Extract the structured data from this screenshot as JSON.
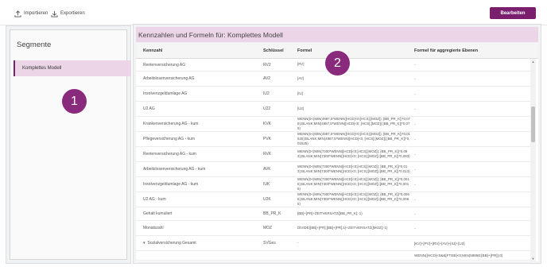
{
  "toolbar": {
    "import_label": "Importieren",
    "export_label": "Exportieren",
    "edit_label": "Bearbeiten"
  },
  "segments": {
    "title": "Segmente",
    "items": [
      {
        "label": "Komplettes Modell"
      }
    ]
  },
  "markers": [
    "1",
    "2"
  ],
  "main": {
    "title": "Kennzahlen und Formeln für: Komplettes Modell",
    "columns": [
      "Kennzahl",
      "Schlüssel",
      "Formel",
      "Formel für aggregierte Ebenen"
    ],
    "rows": [
      {
        "name": "Rentenversicherung AG",
        "key": "RV2",
        "formula": "[RV]",
        "agg": "-"
      },
      {
        "name": "Arbeitslosenversicherung AG",
        "key": "AV2",
        "formula": "[AV]",
        "agg": "-"
      },
      {
        "name": "Insolvenzgeldumlage AG",
        "key": "IU2",
        "formula": "[IU]",
        "agg": "-"
      },
      {
        "name": "U2 AG",
        "key": "U22",
        "formula": "[U2]",
        "agg": "-"
      },
      {
        "name": "Krankenversicherung AG - kum",
        "key": "KVK",
        "formula": "WENN(0<(MIN(4987,5*WENN([HCD]<0;[HCS];[MOZ]); [BB_PR_K])*0,079);BLANK;MIN(4987,5*WENN([HCD]<0; [HCS];[MOZ]);[BB_PR_K])*0,079)",
        "agg": "-"
      },
      {
        "name": "Pflegeversicherung AG - kum",
        "key": "PVK",
        "formula": "WENN(0<(MIN(4987,5*WENN([HCD]<0;[HCS];[MOZ]); [BB_PR_K])*0,01525);BLANK;MIN(4987,5*WENN([HCD]<0; [HCS];[MOZ]);[BB_PR_K])*0,01525)",
        "agg": "-"
      },
      {
        "name": "Rentenversicherung AG - kum",
        "key": "RVK",
        "formula": "WENN(0<(MIN(7300*WENN([HCD]<0;[HCS];[MOZ]); [BB_PR_K])*0,093);BLANK;MIN(7300*WENN([HCD]<0; [HCS];[MOZ]);[BB_PR_K])*0,093)",
        "agg": "-"
      },
      {
        "name": "Arbeitslosenversicherung AG - kum",
        "key": "AVK",
        "formula": "WENN(0<(MIN(7300*WENN([HCD]<0;[HCS];[MOZ]); [BB_PR_K])*0,013);BLANK;MIN(7300*WENN([HCD]<0; [HCS];[MOZ]);[BB_PR_K])*0,013)",
        "agg": "-"
      },
      {
        "name": "Insolvenzgeldumlage AG - kum",
        "key": "IUK",
        "formula": "WENN(0<(MIN(7300*WENN([HCD]<0;[HCS];[MOZ]); [BB_PR_K])*0,0015);BLANK;MIN(7300*WENN([HCD]<0; [HCS];[MOZ]);[BB_PR_K])*0,0015)",
        "agg": "-"
      },
      {
        "name": "U2 AG - kum",
        "key": "U2K",
        "formula": "WENN(0<(MIN(7300*WENN([HCD]<0;[HCS];[MOZ]); [BB_PR_K])*0,0065);BLANK;MIN(7300*WENN([HCD]<0; [HCS];[MOZ]);[BB_PR_K])*0,0065)",
        "agg": "-"
      },
      {
        "name": "Gehalt kumuliert",
        "key": "BB_PR_K",
        "formula": "[BB]+[PR]+ZEITVERSATZ([BB_PR_K];-1)",
        "agg": "-"
      },
      {
        "name": "Monatszahl",
        "key": "MOZ",
        "formula": "DIVIDE([BB]+[PR];[BB]+[PR];1)+ZEITVERSATZ([MOZ];-1)",
        "agg": "-"
      },
      {
        "name": "Sozialversicherung Gesamt",
        "key": "SVGes",
        "formula": "-",
        "agg": "[KV]+[PV]+[RV]+[AV]+[IU]+[U2]",
        "expanded": true
      },
      {
        "name": "",
        "key": "",
        "formula": "",
        "agg": "WENN([HCD]<0&&[FTEB]<0;MIN(59850;[BB]+[PR]);0)",
        "sub": true
      }
    ]
  }
}
